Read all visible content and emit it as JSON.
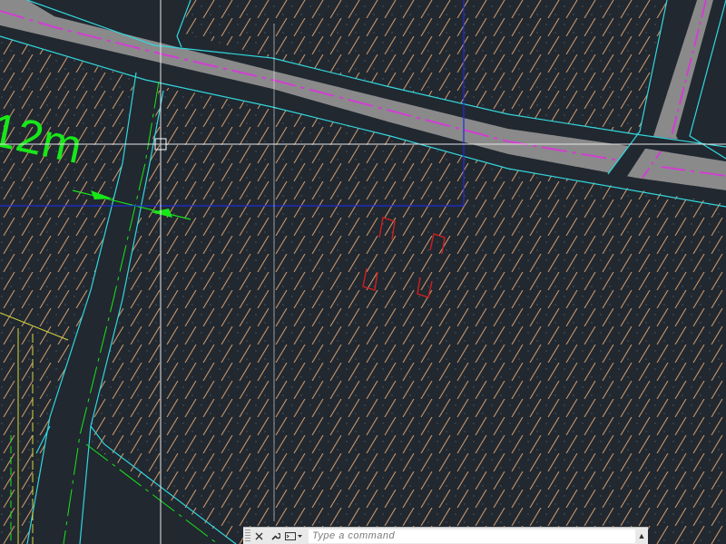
{
  "drawing": {
    "dimension_label": "12m",
    "layers": {
      "background": "#212830",
      "boundary_cyan": "#33d6dc",
      "road_fill": "#8a8a8a",
      "road_centerline": "#d23ed2",
      "hatch_tan": "#d4a06a",
      "dimension_green": "#19e619",
      "crosshair": "#e6e6e6",
      "selection_window": "#1f2bd8",
      "object_red": "#d01f1f",
      "boundary_yellow": "#d8d83a"
    }
  },
  "command_line": {
    "placeholder": "Type a command",
    "close_icon": "close-icon",
    "customize_icon": "wrench-icon",
    "recent_commands_icon": "command-prompt-icon",
    "scroll_icon": "scroll-up-icon"
  }
}
